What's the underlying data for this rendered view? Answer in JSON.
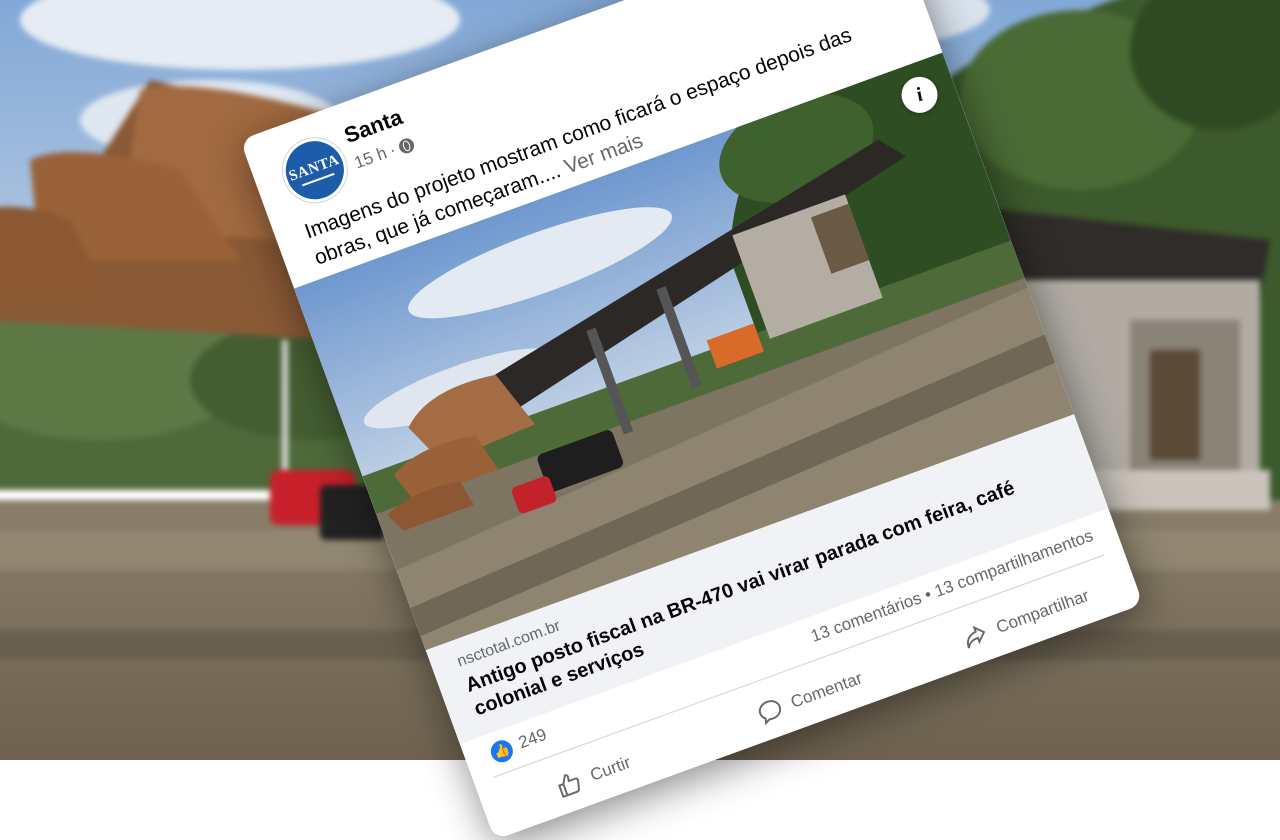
{
  "post": {
    "page_name": "Santa",
    "time": "15 h",
    "separator": "·",
    "privacy_icon": "globe-icon",
    "avatar_text": "SANTA",
    "caption": "Imagens do projeto mostram como ficará o espaço depois das obras, que já começaram....",
    "see_more": "Ver mais",
    "info_icon_text": "i"
  },
  "link": {
    "domain": "nsctotal.com.br",
    "title": "Antigo posto fiscal na BR-470 vai virar parada com feira, café colonial e serviços"
  },
  "stats": {
    "like_icon": "thumbs-up-icon",
    "likes": "249",
    "comments": "13 comentários",
    "dot": "•",
    "shares": "13 compartilhamentos"
  },
  "actions": {
    "like": "Curtir",
    "comment": "Comentar",
    "share": "Compartilhar"
  },
  "colors": {
    "facebook_blue": "#1877f2",
    "secondary_text": "#65676b",
    "link_box_bg": "#f0f2f5"
  }
}
